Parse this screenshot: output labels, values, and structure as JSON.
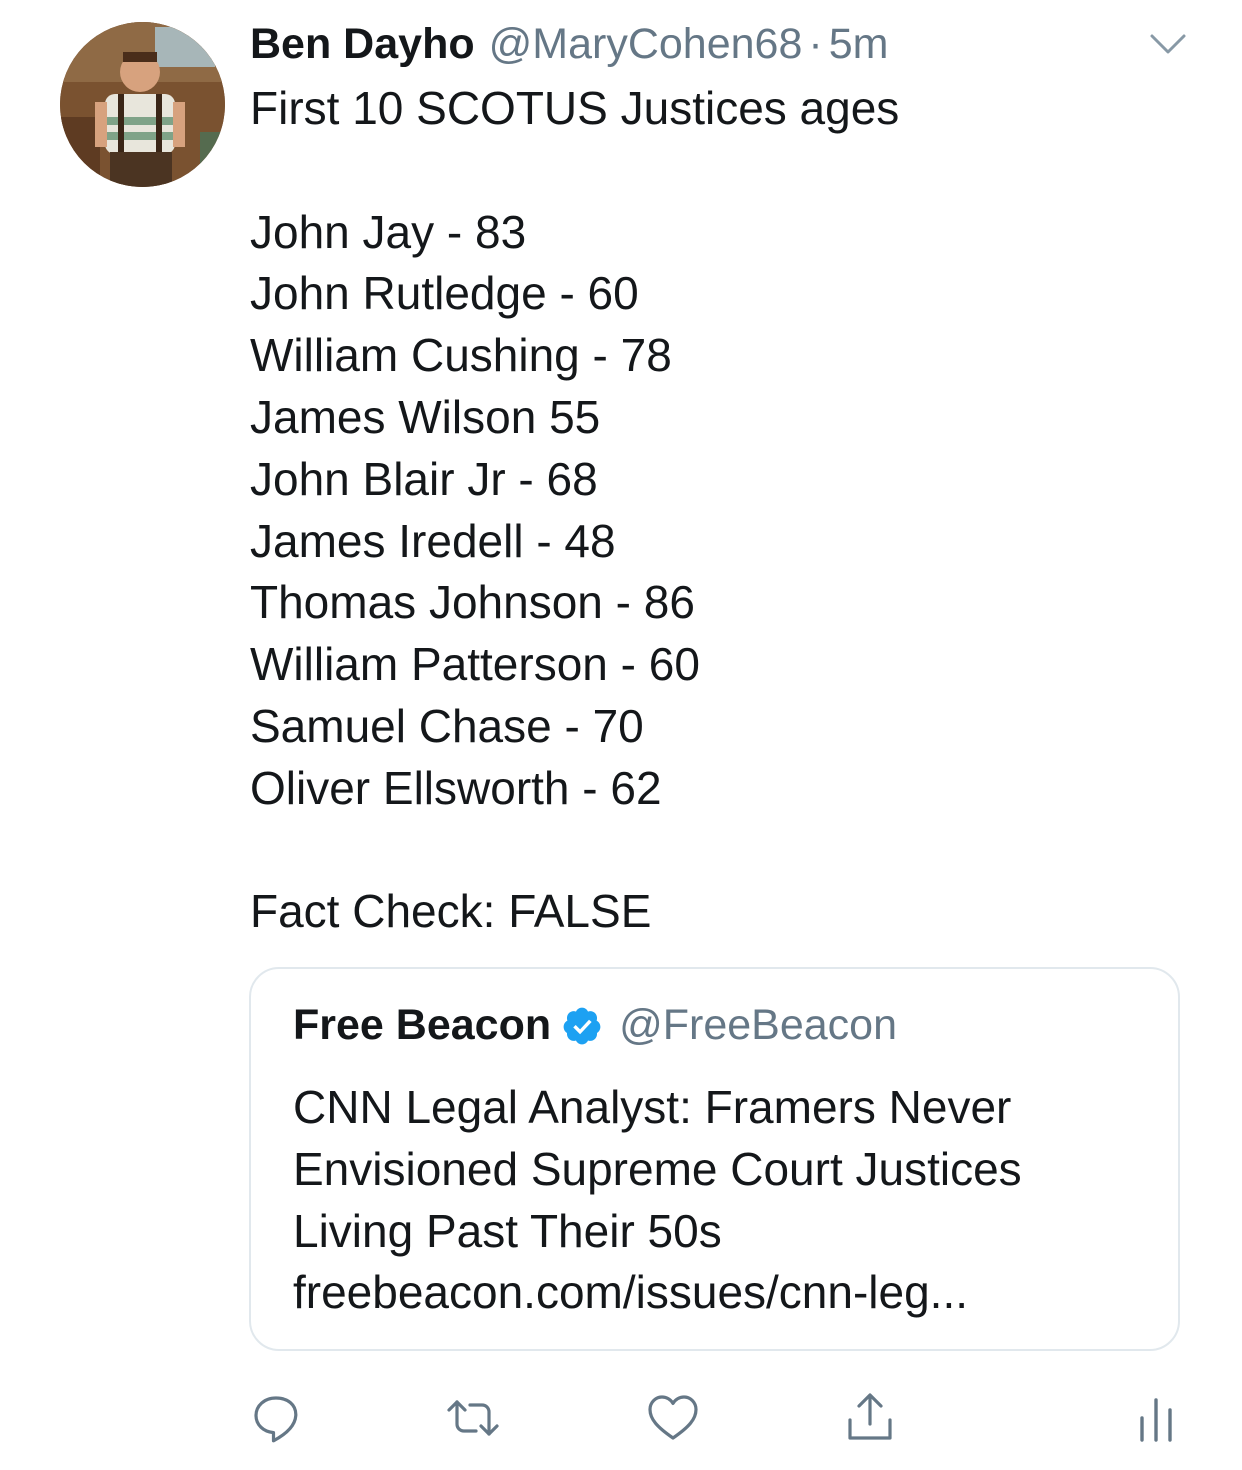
{
  "tweet": {
    "author_name": "Ben Dayho",
    "author_handle": "@MaryCohen68",
    "separator": "·",
    "time": "5m",
    "text_intro": "First 10 SCOTUS Justices ages",
    "justices": [
      "John Jay - 83",
      "John Rutledge - 60",
      "William Cushing - 78",
      "James Wilson 55",
      "John Blair Jr - 68",
      "James Iredell - 48",
      "Thomas Johnson - 86",
      "William Patterson - 60",
      "Samuel Chase - 70",
      "Oliver Ellsworth - 62"
    ],
    "text_outro": "Fact Check: FALSE"
  },
  "quoted_tweet": {
    "author_name": "Free Beacon",
    "verified": true,
    "author_handle": "@FreeBeacon",
    "lines": [
      "CNN Legal Analyst: Framers Never",
      "Envisioned Supreme Court Justices",
      "Living Past Their 50s",
      "freebeacon.com/issues/cnn-leg..."
    ]
  },
  "icons": {
    "menu": "chevron-down-icon",
    "reply": "reply-icon",
    "retweet": "retweet-icon",
    "like": "heart-icon",
    "share": "share-icon",
    "analytics": "analytics-icon",
    "verified": "verified-badge-icon"
  },
  "colors": {
    "text": "#14171a",
    "secondary": "#657786",
    "verified": "#1da1f2",
    "border": "#e1e8ed"
  }
}
